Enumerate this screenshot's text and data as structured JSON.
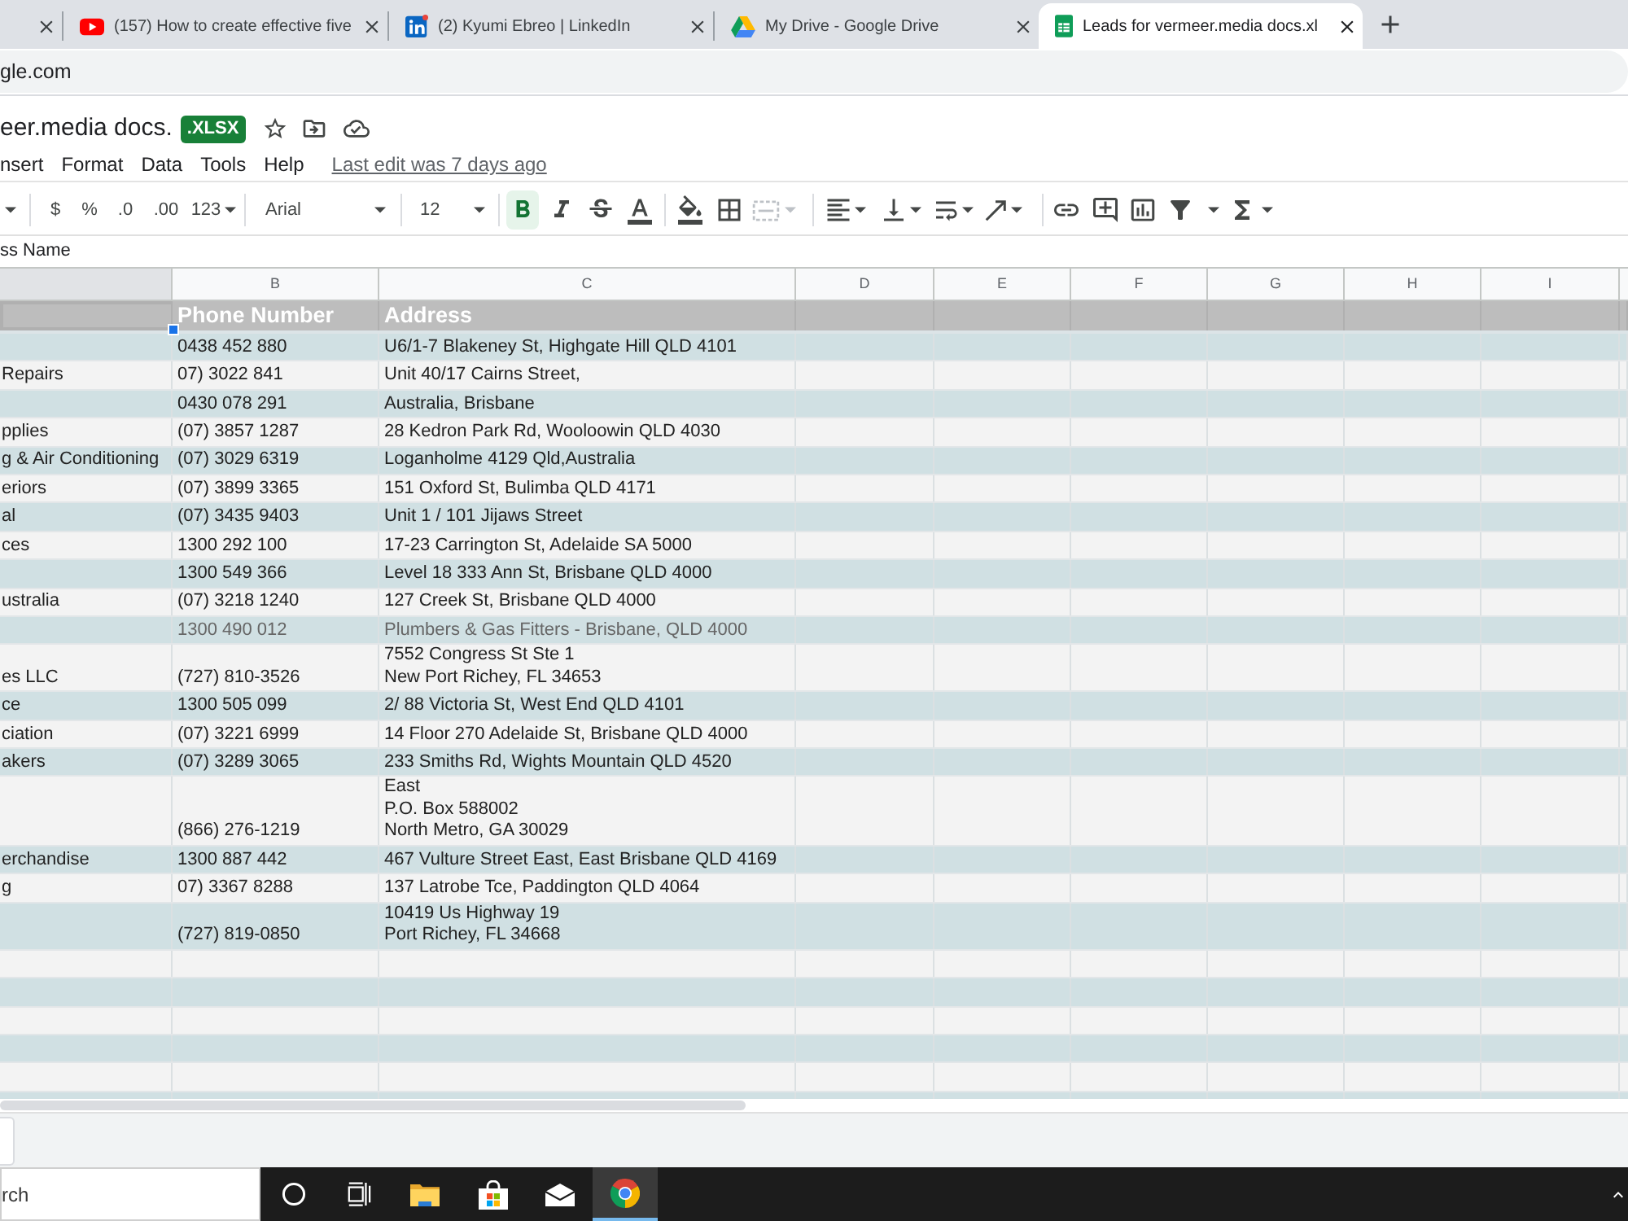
{
  "browser": {
    "tabs": [
      {
        "selected": false
      },
      {
        "kind": "youtube",
        "title": "(157) How to create effective five",
        "selected": false
      },
      {
        "kind": "linkedin",
        "title": "(2) Kyumi Ebreo | LinkedIn",
        "selected": false
      },
      {
        "kind": "drive",
        "title": "My Drive - Google Drive",
        "selected": false
      },
      {
        "kind": "sheets",
        "title": "Leads for vermeer.media docs.xl",
        "selected": true
      }
    ],
    "address": "gle.com"
  },
  "document": {
    "title": "eer.media docs.",
    "badge": ".XLSX",
    "menu": [
      "nsert",
      "Format",
      "Data",
      "Tools",
      "Help"
    ],
    "last_edit": "Last edit was 7 days ago"
  },
  "toolbar": {
    "currency": "$",
    "percent": "%",
    "decrease_decimal": ".0",
    "increase_decimal": ".00",
    "more_formats": "123",
    "font": "Arial",
    "font_size": "12",
    "bold": true,
    "italic": false,
    "strikethrough": false,
    "merge_disabled": true
  },
  "formula_bar": {
    "value": "ss Name"
  },
  "sheet": {
    "columns": [
      {
        "selected": true
      },
      {
        "label": "B",
        "selected": false
      },
      {
        "label": "C",
        "selected": false
      },
      {
        "label": "D",
        "selected": false
      },
      {
        "label": "E",
        "selected": false
      },
      {
        "label": "F",
        "selected": false
      },
      {
        "label": "G",
        "selected": false
      },
      {
        "label": "H",
        "selected": false
      },
      {
        "label": "I",
        "selected": false
      }
    ],
    "header_row": [
      {
        "selected": true
      },
      {
        "text": "Phone Number",
        "selected": false
      },
      {
        "text": "Address",
        "selected": false
      }
    ],
    "rows": [
      {
        "phone": "0438 452 880",
        "address": "U6/1-7 Blakeney St, Highgate Hill QLD 4101",
        "muted": false
      },
      {
        "column_a": "Repairs",
        "phone": "07) 3022 841",
        "address": "Unit 40/17 Cairns Street,",
        "muted": false
      },
      {
        "phone": "0430 078 291",
        "address": "Australia, Brisbane",
        "muted": false
      },
      {
        "column_a": "pplies",
        "phone": "(07) 3857 1287",
        "address": "28 Kedron Park Rd, Wooloowin QLD 4030",
        "muted": false
      },
      {
        "column_a": "g & Air Conditioning",
        "phone": "(07) 3029 6319",
        "address": "Loganholme 4129 Qld,Australia",
        "muted": false
      },
      {
        "column_a": "eriors",
        "phone": "(07) 3899 3365",
        "address": "151 Oxford St, Bulimba QLD 4171",
        "muted": false
      },
      {
        "column_a": "al",
        "phone": "(07) 3435 9403",
        "address": "Unit 1 / 101 Jijaws Street",
        "muted": false
      },
      {
        "column_a": "ces",
        "phone": "1300 292 100",
        "address": "17-23 Carrington St, Adelaide SA 5000",
        "muted": false
      },
      {
        "phone": "1300 549 366",
        "address": "Level 18 333 Ann St, Brisbane QLD 4000",
        "muted": false
      },
      {
        "column_a": "ustralia",
        "phone": "(07) 3218 1240",
        "address": "127 Creek St, Brisbane QLD 4000",
        "muted": false
      },
      {
        "phone": "1300 490 012",
        "address": "Plumbers & Gas Fitters - Brisbane, QLD 4000",
        "muted": true
      },
      {
        "column_a": "es LLC",
        "phone": "(727) 810-3526",
        "address": "7552 Congress St Ste 1\nNew Port Richey, FL 34653",
        "muted": false
      },
      {
        "column_a": "ce",
        "phone": "1300 505 099",
        "address": "2/ 88 Victoria St, West End QLD 4101",
        "muted": false
      },
      {
        "column_a": "ciation",
        "phone": "(07) 3221 6999",
        "address": "14 Floor 270 Adelaide St, Brisbane QLD 4000",
        "muted": false
      },
      {
        "column_a": "akers",
        "phone": "(07) 3289 3065",
        "address": "233 Smiths Rd, Wights Mountain QLD 4520",
        "muted": false
      },
      {
        "phone": "(866) 276-1219",
        "address": "East\nP.O. Box 588002\nNorth Metro, GA 30029",
        "muted": false
      },
      {
        "column_a": "erchandise",
        "phone": "1300 887 442",
        "address": "467 Vulture Street East, East Brisbane QLD 4169",
        "muted": false
      },
      {
        "column_a": "g",
        "phone": "07) 3367 8288",
        "address": "137 Latrobe Tce, Paddington QLD 4064",
        "muted": false
      },
      {
        "phone": "(727) 819-0850",
        "address": "10419 Us Highway 19\nPort Richey, FL 34668",
        "muted": false
      }
    ]
  },
  "taskbar": {
    "placeholder": "rch",
    "apps": [
      {
        "kind": "cortana",
        "selected": false
      },
      {
        "kind": "task_view",
        "selected": false
      },
      {
        "kind": "explorer",
        "selected": false
      },
      {
        "kind": "store",
        "selected": false
      },
      {
        "kind": "mail",
        "selected": false
      },
      {
        "kind": "chrome",
        "selected": true
      }
    ]
  }
}
